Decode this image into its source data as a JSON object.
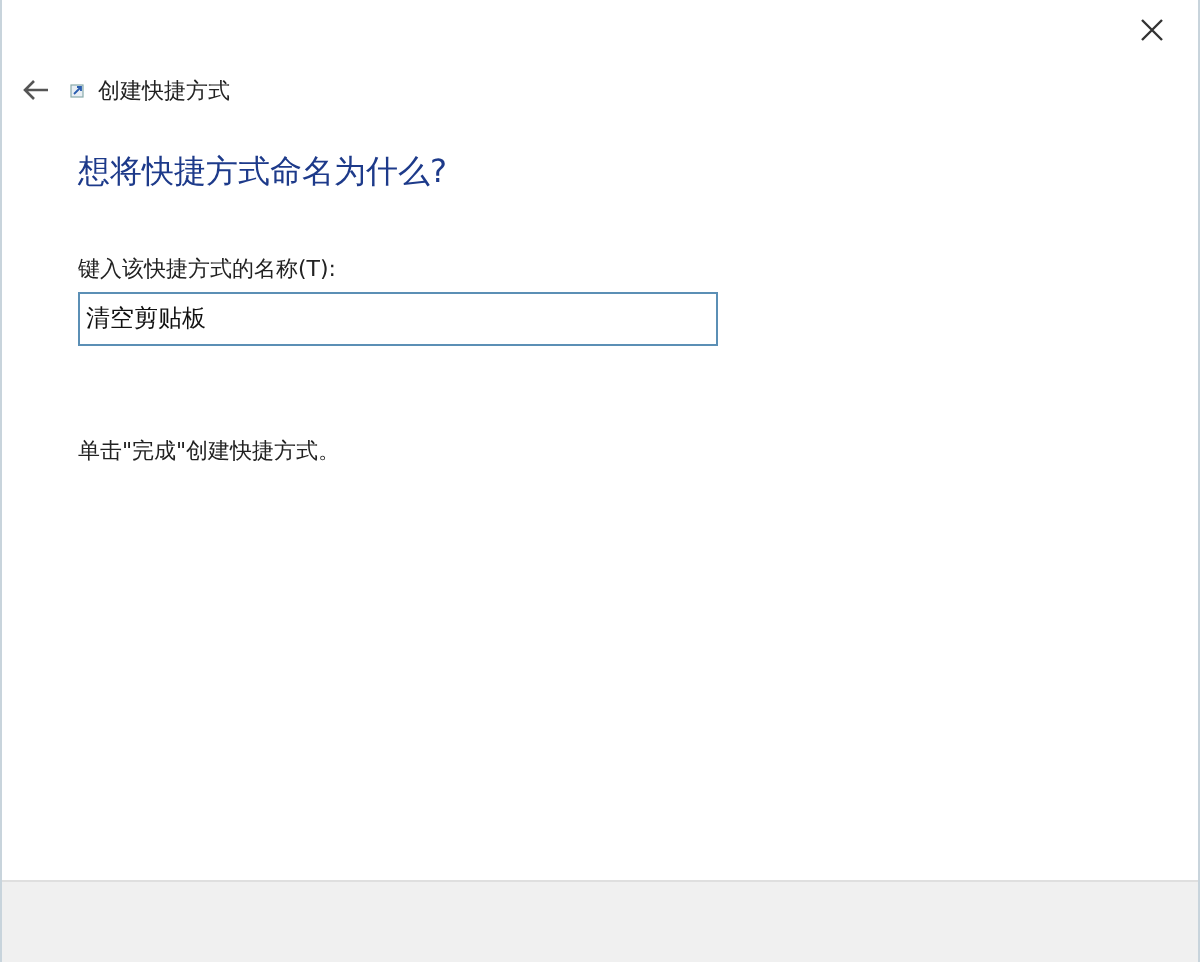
{
  "window": {
    "title": "创建快捷方式"
  },
  "heading": "想将快捷方式命名为什么?",
  "name_field": {
    "label": "键入该快捷方式的名称(T):",
    "value": "清空剪贴板"
  },
  "instruction": "单击\"完成\"创建快捷方式。"
}
